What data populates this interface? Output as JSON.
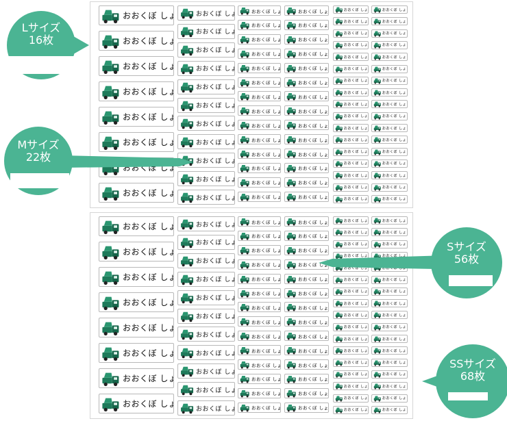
{
  "label_name": "おおくぼ しょうへい",
  "accent_color": "#4bb493",
  "truck_icon": "garbage-truck-icon",
  "sheets": [
    "upper-sheet",
    "lower-sheet"
  ],
  "callouts": {
    "L": {
      "size": "Lサイズ",
      "count": "16枚"
    },
    "M": {
      "size": "Mサイズ",
      "count": "22枚"
    },
    "S": {
      "size": "Sサイズ",
      "count": "56枚"
    },
    "SS": {
      "size": "SSサイズ",
      "count": "68枚"
    }
  }
}
